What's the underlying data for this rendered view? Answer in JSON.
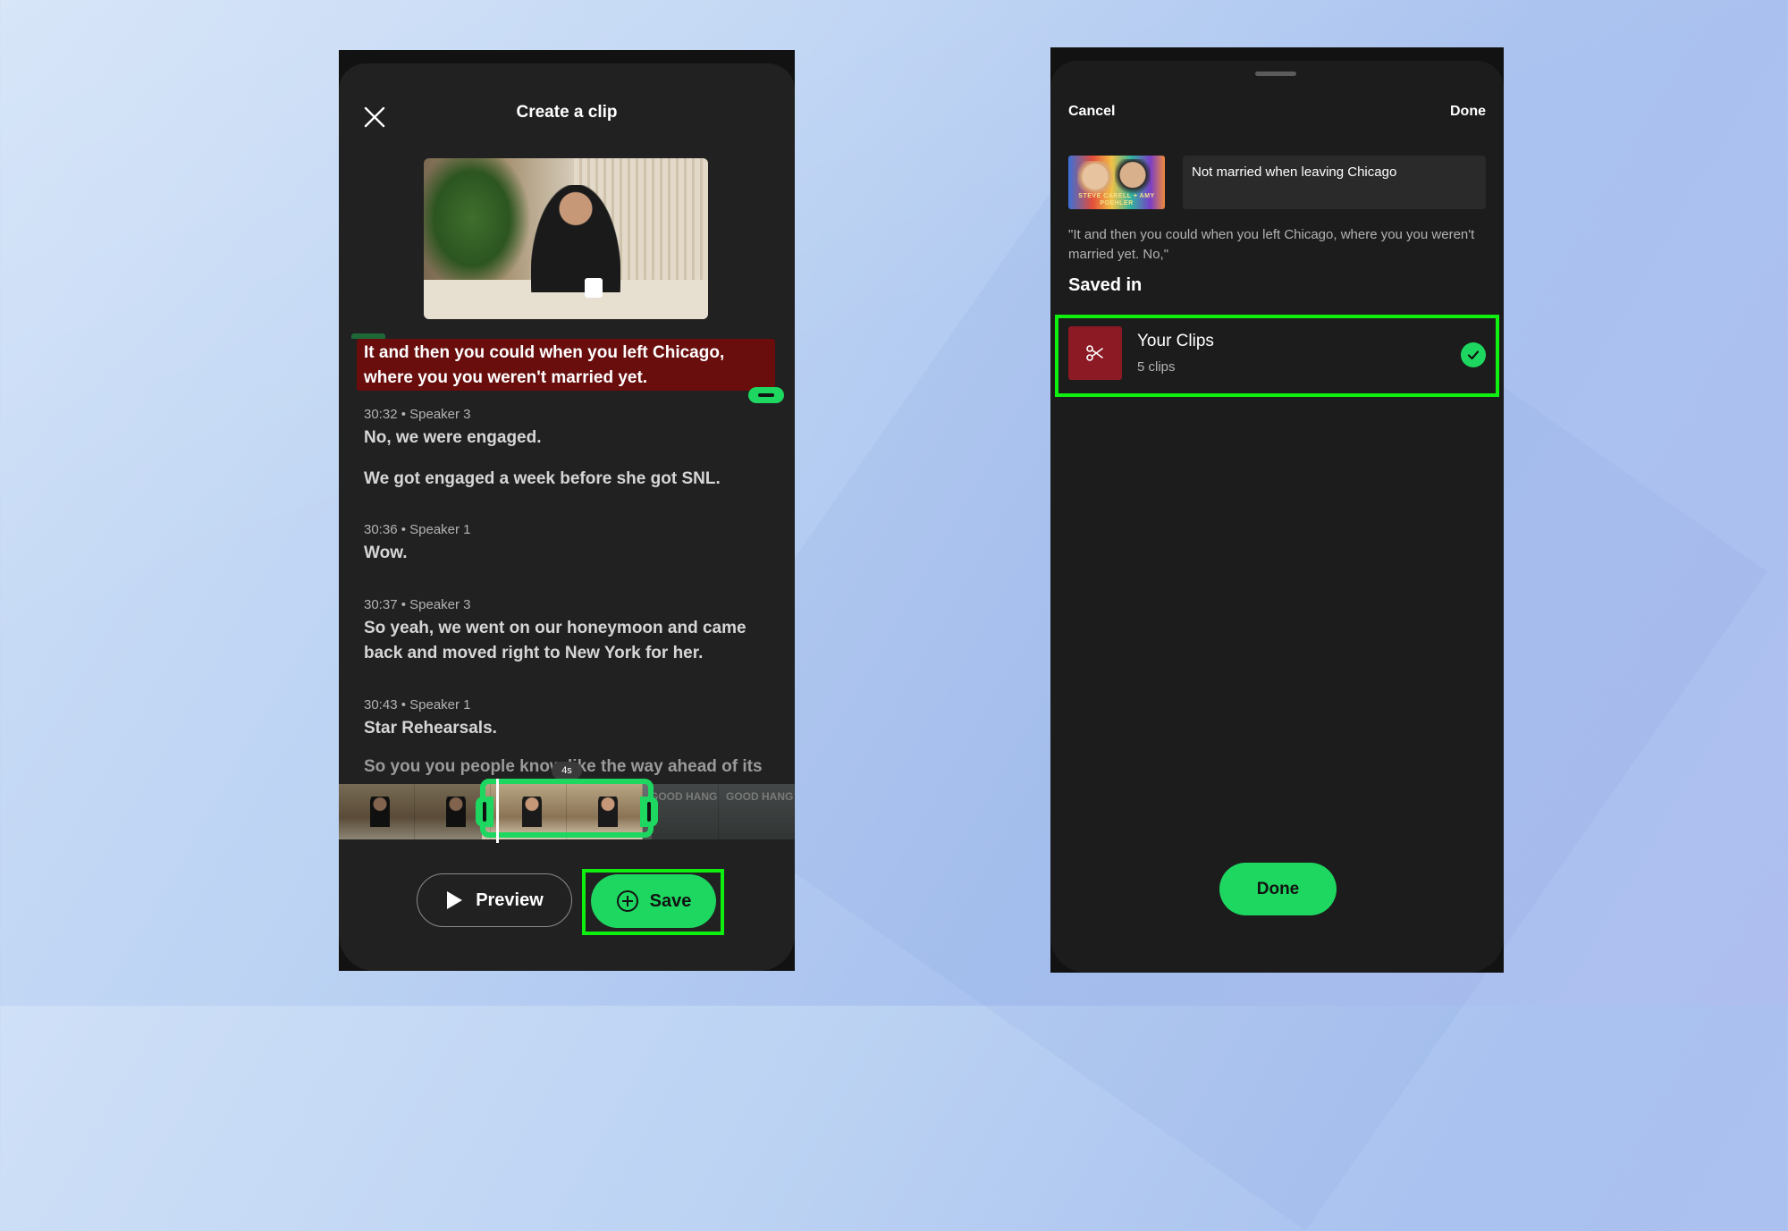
{
  "left_screen": {
    "title": "Create a clip",
    "highlighted_text": "It and then you could when you left Chicago, where you you weren't married yet.",
    "transcript": [
      {
        "meta": "30:32 • Speaker 3"
      },
      {
        "line": "No, we were engaged."
      },
      {
        "line": "We got engaged a week before she got SNL."
      },
      {
        "meta": "30:36 • Speaker 1"
      },
      {
        "line": "Wow."
      },
      {
        "meta": "30:37 • Speaker 3"
      },
      {
        "line": "So yeah, we went on our honeymoon and came back and moved right to New York for her."
      },
      {
        "meta": "30:43 • Speaker 1"
      },
      {
        "line": "Star Rehearsals."
      },
      {
        "line": "So you you people know like the way ahead of its"
      }
    ],
    "duration_badge": "4s",
    "filmstrip_overlay_text": "GOOD HANG",
    "preview_label": "Preview",
    "save_label": "Save"
  },
  "right_screen": {
    "cancel_label": "Cancel",
    "done_top_label": "Done",
    "cover_caption": "STEVE CARELL + AMY POEHLER",
    "clip_title_value": "Not married when leaving Chicago",
    "quote": "\"It and then you could when you left Chicago, where you you weren't married yet. No,\"",
    "saved_in_label": "Saved in",
    "playlist": {
      "name": "Your Clips",
      "count": "5 clips",
      "selected": true
    },
    "done_button_label": "Done"
  },
  "colors": {
    "accent": "#1ed760",
    "highlight_bg": "#6a0d0d",
    "playlist_icon_bg": "#8b1a24",
    "annotation_outline": "#10f010"
  },
  "icons": [
    "close-icon",
    "play-icon",
    "plus-circle-icon",
    "scissors-icon",
    "check-icon"
  ]
}
